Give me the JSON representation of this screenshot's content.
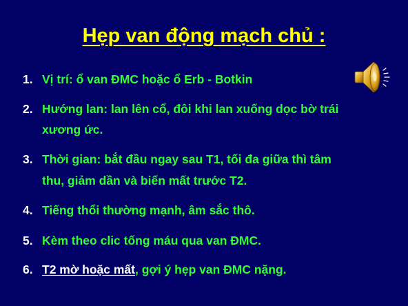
{
  "slide": {
    "title": "Hẹp van động mạch chủ :",
    "items": [
      {
        "number": "1.",
        "lines": [
          "Vị trí: ổ van ĐMC hoặc ổ Erb - Botkin"
        ]
      },
      {
        "number": "2.",
        "lines": [
          "Hướng lan: lan lên cổ, đôi khi lan xuống dọc bờ trái",
          "xương ức."
        ]
      },
      {
        "number": "3.",
        "lines": [
          "Thời gian: bắt đầu ngay sau T1, tối đa giữa thì tâm",
          "thu, giảm dần và biến mất trước T2."
        ]
      },
      {
        "number": "4.",
        "lines": [
          "Tiếng thổi thường mạnh, âm sắc thô."
        ]
      },
      {
        "number": "5.",
        "lines": [
          "Kèm theo clic tống máu qua van ĐMC."
        ]
      },
      {
        "number": "6.",
        "underlined": "T2 mờ hoặc mất",
        "rest": ", gợi ý hẹp van ĐMC nặng."
      }
    ],
    "speaker_icon": "speaker-sound-icon",
    "colors": {
      "background": "#000066",
      "title": "#ffff00",
      "text_green": "#33ff33",
      "text_white": "#ffffff"
    }
  }
}
